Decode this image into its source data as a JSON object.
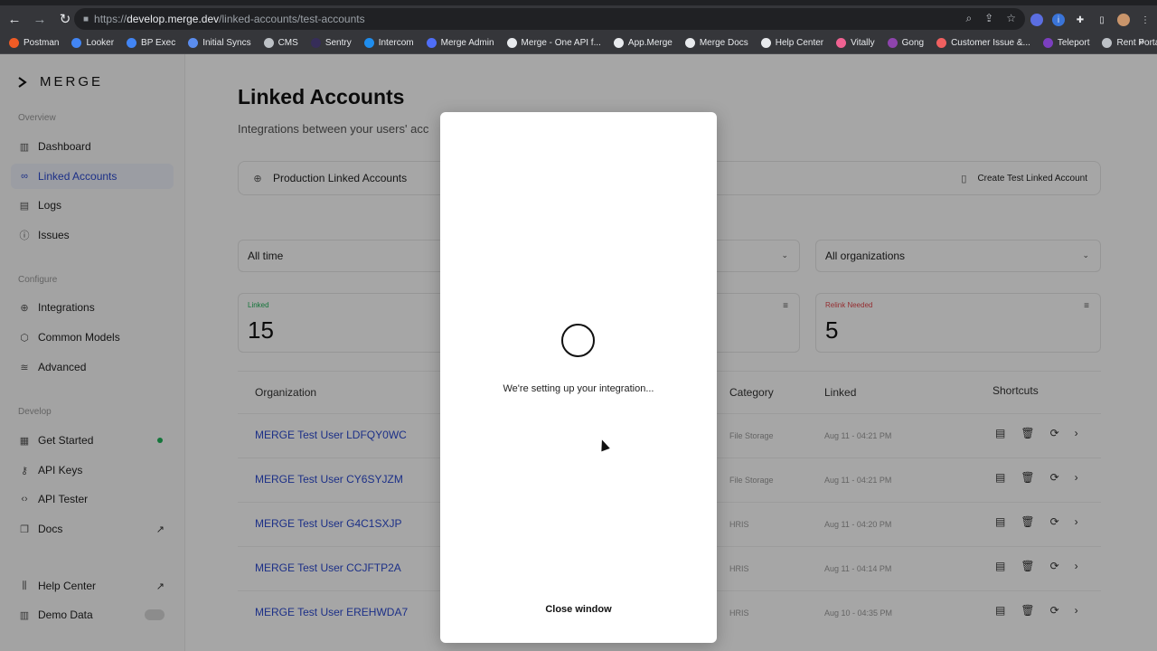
{
  "browser": {
    "url_prefix": "https://",
    "url_host": "develop.merge.dev",
    "url_path": "/linked-accounts/test-accounts",
    "bookmarks": [
      {
        "label": "Postman",
        "color": "#ef5b25"
      },
      {
        "label": "Looker",
        "color": "#4285f4"
      },
      {
        "label": "BP Exec",
        "color": "#4285f4"
      },
      {
        "label": "Initial Syncs",
        "color": "#5b8def"
      },
      {
        "label": "CMS",
        "color": "#bdc1c6"
      },
      {
        "label": "Sentry",
        "color": "#362d59"
      },
      {
        "label": "Intercom",
        "color": "#1f8ded"
      },
      {
        "label": "Merge Admin",
        "color": "#4f6ef7"
      },
      {
        "label": "Merge - One API f...",
        "color": "#e8eaed"
      },
      {
        "label": "App.Merge",
        "color": "#e8eaed"
      },
      {
        "label": "Merge Docs",
        "color": "#e8eaed"
      },
      {
        "label": "Help Center",
        "color": "#e8eaed"
      },
      {
        "label": "Vitally",
        "color": "#f06292"
      },
      {
        "label": "Gong",
        "color": "#8e44ad"
      },
      {
        "label": "Customer Issue &...",
        "color": "#f06060"
      },
      {
        "label": "Teleport",
        "color": "#7b3fbf"
      },
      {
        "label": "Rent Portal",
        "color": "#bdc1c6"
      }
    ],
    "more": "»"
  },
  "sidebar": {
    "logo": "MERGE",
    "overview_label": "Overview",
    "configure_label": "Configure",
    "develop_label": "Develop",
    "items": {
      "dashboard": "Dashboard",
      "linked_accounts": "Linked Accounts",
      "logs": "Logs",
      "issues": "Issues",
      "integrations": "Integrations",
      "common_models": "Common Models",
      "advanced": "Advanced",
      "get_started": "Get Started",
      "api_keys": "API Keys",
      "api_tester": "API Tester",
      "docs": "Docs",
      "help_center": "Help Center",
      "demo_data": "Demo Data"
    }
  },
  "main": {
    "title": "Linked Accounts",
    "subtitle": "Integrations between your users' acc",
    "tab_production": "Production Linked Accounts",
    "create_test": "Create Test Linked Account",
    "filter_time": "All time",
    "filter_org": "All organizations",
    "stat_linked_label": "Linked",
    "stat_linked_value": "15",
    "stat_relink_label": "Relink Needed",
    "stat_relink_value": "5",
    "columns": {
      "organization": "Organization",
      "category": "Category",
      "linked": "Linked",
      "shortcuts": "Shortcuts"
    },
    "rows": [
      {
        "org": "MERGE Test User LDFQY0WC",
        "category": "File Storage",
        "linked": "Aug 11 - 04:21 PM"
      },
      {
        "org": "MERGE Test User CY6SYJZM",
        "category": "File Storage",
        "linked": "Aug 11 - 04:21 PM"
      },
      {
        "org": "MERGE Test User G4C1SXJP",
        "category": "HRIS",
        "linked": "Aug 11 - 04:20 PM"
      },
      {
        "org": "MERGE Test User CCJFTP2A",
        "category": "HRIS",
        "linked": "Aug 11 - 04:14 PM"
      },
      {
        "org": "MERGE Test User EREHWDA7",
        "category": "HRIS",
        "linked": "Aug 10 - 04:35 PM"
      }
    ]
  },
  "modal": {
    "message": "We're setting up your integration...",
    "close": "Close window"
  },
  "colors": {
    "accent": "#2c4ad0",
    "linked_green": "#20b45a",
    "relink_red": "#e5484d"
  }
}
